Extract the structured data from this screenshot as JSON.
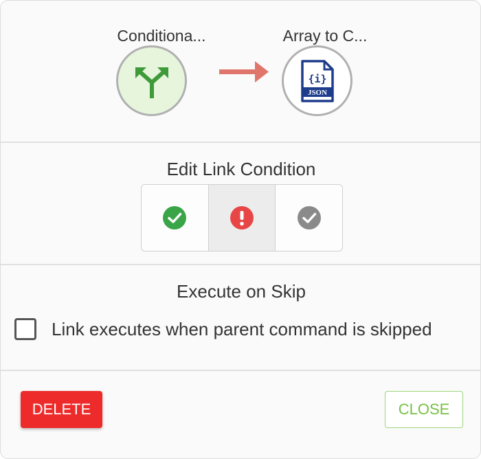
{
  "link": {
    "source_label": "Conditiona...",
    "source_icon": "branch-split-icon",
    "target_label": "Array to C...",
    "target_icon": "json-file-icon",
    "target_icon_badge": "JSON",
    "target_icon_glyph": "{i}",
    "arrow_color": "#e0756c"
  },
  "condition": {
    "title": "Edit Link Condition",
    "options": [
      {
        "name": "success",
        "icon": "check-circle-icon",
        "color": "#3aa548",
        "selected": false
      },
      {
        "name": "failure",
        "icon": "exclamation-circle-icon",
        "color": "#e84646",
        "selected": true
      },
      {
        "name": "complete",
        "icon": "check-circle-gray-icon",
        "color": "#8a8a8a",
        "selected": false
      }
    ]
  },
  "skip": {
    "title": "Execute on Skip",
    "checkbox_label": "Link executes when parent command is skipped",
    "checked": false
  },
  "actions": {
    "delete_label": "DELETE",
    "close_label": "CLOSE",
    "delete_color": "#ed2b2b",
    "close_color": "#76c043"
  }
}
